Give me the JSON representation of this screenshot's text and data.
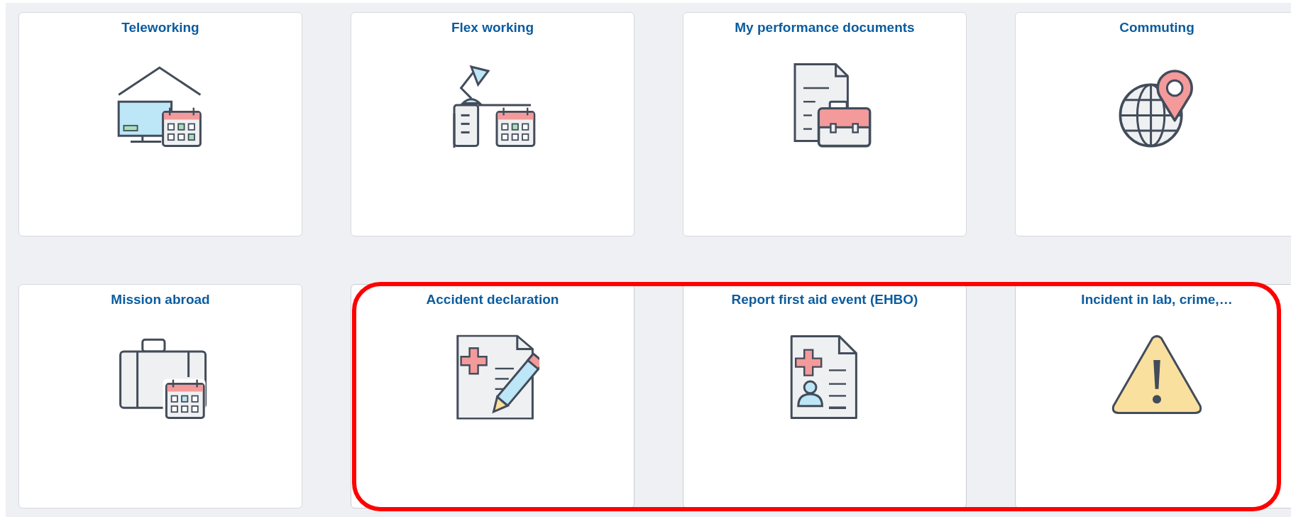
{
  "tiles": [
    {
      "title": "Teleworking",
      "kind": "home-office",
      "highlighted": false
    },
    {
      "title": "Flex working",
      "kind": "desk",
      "highlighted": false
    },
    {
      "title": "My performance documents",
      "kind": "documents",
      "highlighted": false
    },
    {
      "title": "Commuting",
      "kind": "globe",
      "highlighted": false
    },
    {
      "title": "Mission abroad",
      "kind": "suitcase",
      "highlighted": false
    },
    {
      "title": "Accident declaration",
      "kind": "medical-edit",
      "highlighted": true
    },
    {
      "title": "Report first aid event (EHBO)",
      "kind": "medical-report",
      "highlighted": true
    },
    {
      "title": "Incident in lab, crime,…",
      "kind": "warning",
      "highlighted": true
    }
  ]
}
